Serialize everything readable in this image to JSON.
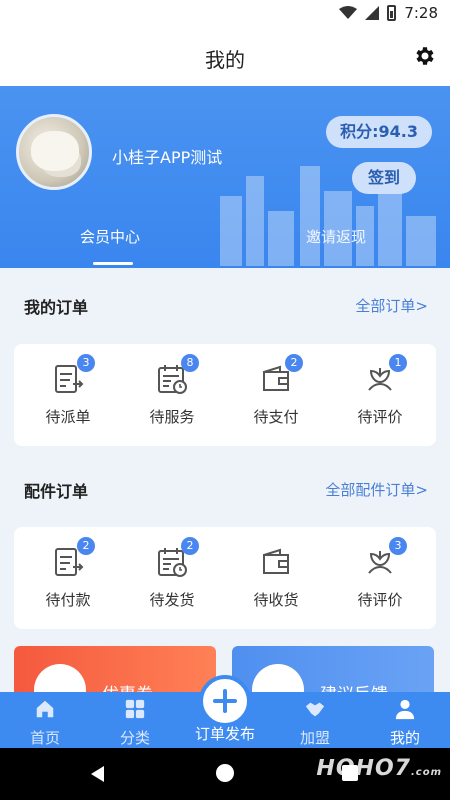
{
  "status_bar": {
    "time": "7:28"
  },
  "header": {
    "title": "我的"
  },
  "profile": {
    "username": "小桂子APP测试",
    "points": "积分:94.3",
    "checkin": "签到",
    "tabs": [
      "会员中心",
      "邀请返现"
    ]
  },
  "orders": {
    "title": "我的订单",
    "more": "全部订单>",
    "items": [
      {
        "label": "待派单",
        "badge": "3",
        "icon": "dispatch-list-icon"
      },
      {
        "label": "待服务",
        "badge": "8",
        "icon": "calendar-clock-icon"
      },
      {
        "label": "待支付",
        "badge": "2",
        "icon": "wallet-icon"
      },
      {
        "label": "待评价",
        "badge": "1",
        "icon": "flower-icon"
      }
    ]
  },
  "parts_orders": {
    "title": "配件订单",
    "more": "全部配件订单>",
    "items": [
      {
        "label": "待付款",
        "badge": "2",
        "icon": "dispatch-list-icon"
      },
      {
        "label": "待发货",
        "badge": "2",
        "icon": "calendar-clock-icon"
      },
      {
        "label": "待收货",
        "badge": "",
        "icon": "wallet-icon"
      },
      {
        "label": "待评价",
        "badge": "3",
        "icon": "flower-icon"
      }
    ]
  },
  "promos": {
    "coupon": "优惠券",
    "feedback": "建议反馈"
  },
  "tabbar": {
    "items": [
      "首页",
      "分类",
      "订单发布",
      "加盟",
      "我的"
    ],
    "active": "我的"
  },
  "watermark": {
    "main": "ᕼOᕼO7",
    "domain": ".com"
  },
  "colors": {
    "primary": "#3d8af0",
    "badge": "#4a86ef",
    "coupon": "#f5593e"
  }
}
